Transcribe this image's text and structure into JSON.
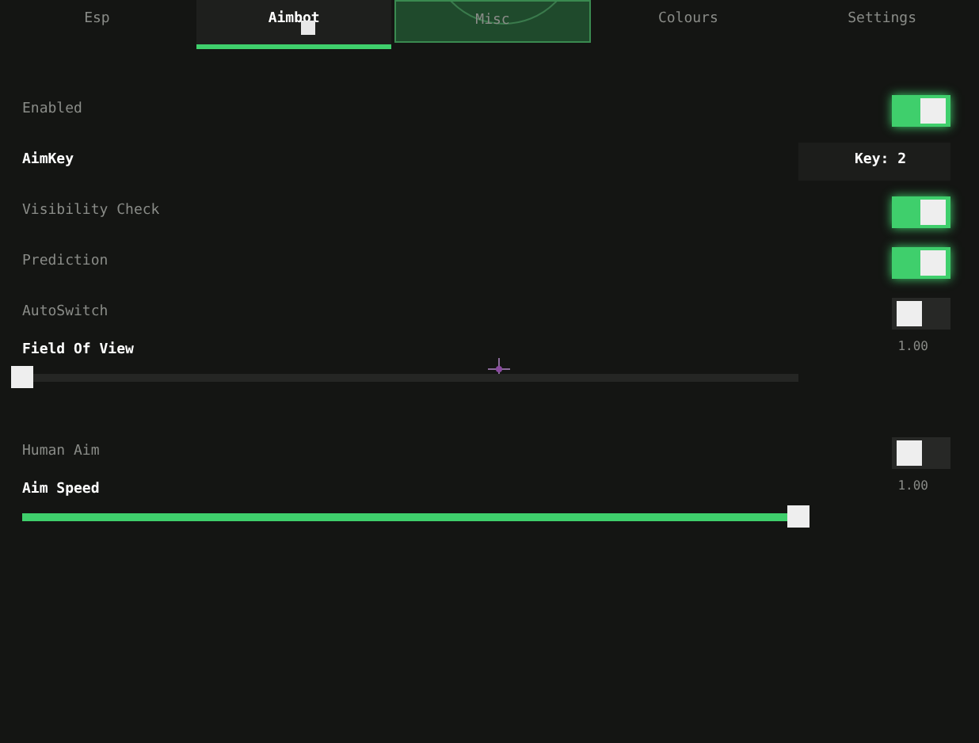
{
  "tabs": [
    {
      "label": "Esp",
      "selected": false,
      "highlighted": false
    },
    {
      "label": "Aimbot",
      "selected": true,
      "highlighted": false
    },
    {
      "label": "Misc",
      "selected": false,
      "highlighted": true
    },
    {
      "label": "Colours",
      "selected": false,
      "highlighted": false
    },
    {
      "label": "Settings",
      "selected": false,
      "highlighted": false
    }
  ],
  "rows": [
    {
      "kind": "toggle",
      "label": "Enabled",
      "on": true
    },
    {
      "kind": "key",
      "label": "AimKey",
      "value": "Key: 2"
    },
    {
      "kind": "toggle",
      "label": "Visibility Check",
      "on": true
    },
    {
      "kind": "toggle",
      "label": "Prediction",
      "on": true
    },
    {
      "kind": "toggle",
      "label": "AutoSwitch",
      "on": false
    },
    {
      "kind": "slider",
      "label": "Field Of View",
      "value": "1.00",
      "level": 0
    },
    {
      "kind": "toggle",
      "label": "Human Aim",
      "on": false
    },
    {
      "kind": "slider",
      "label": "Aim Speed",
      "value": "1.00",
      "level": 1
    }
  ]
}
